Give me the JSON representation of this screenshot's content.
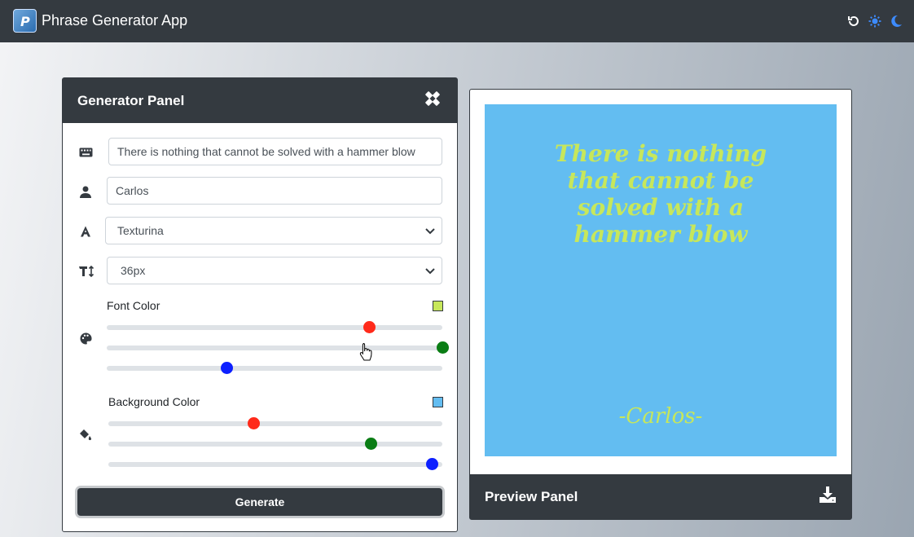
{
  "navbar": {
    "title": "Phrase Generator App",
    "icons": [
      "reset-icon",
      "sun-icon",
      "moon-icon"
    ],
    "accent": "#3d8bfd"
  },
  "generator": {
    "title": "Generator Panel",
    "phrase_value": "There is nothing that cannot be solved with a hammer blow",
    "author_value": "Carlos",
    "font_value": "Texturina",
    "size_value": "36px",
    "font_color": {
      "label": "Font Color",
      "swatch": "#c7e75b",
      "red": 199,
      "green": 255,
      "blue": 91
    },
    "bg_color": {
      "label": "Background Color",
      "swatch": "#63bdf1",
      "red": 111,
      "green": 200,
      "blue": 247
    },
    "generate_label": "Generate"
  },
  "preview": {
    "title": "Preview Panel",
    "quote": "There is nothing that cannot be solved with a hammer blow",
    "author": "-Carlos-",
    "text_color": "#c7e75b",
    "bg_color": "#63bdf1"
  }
}
